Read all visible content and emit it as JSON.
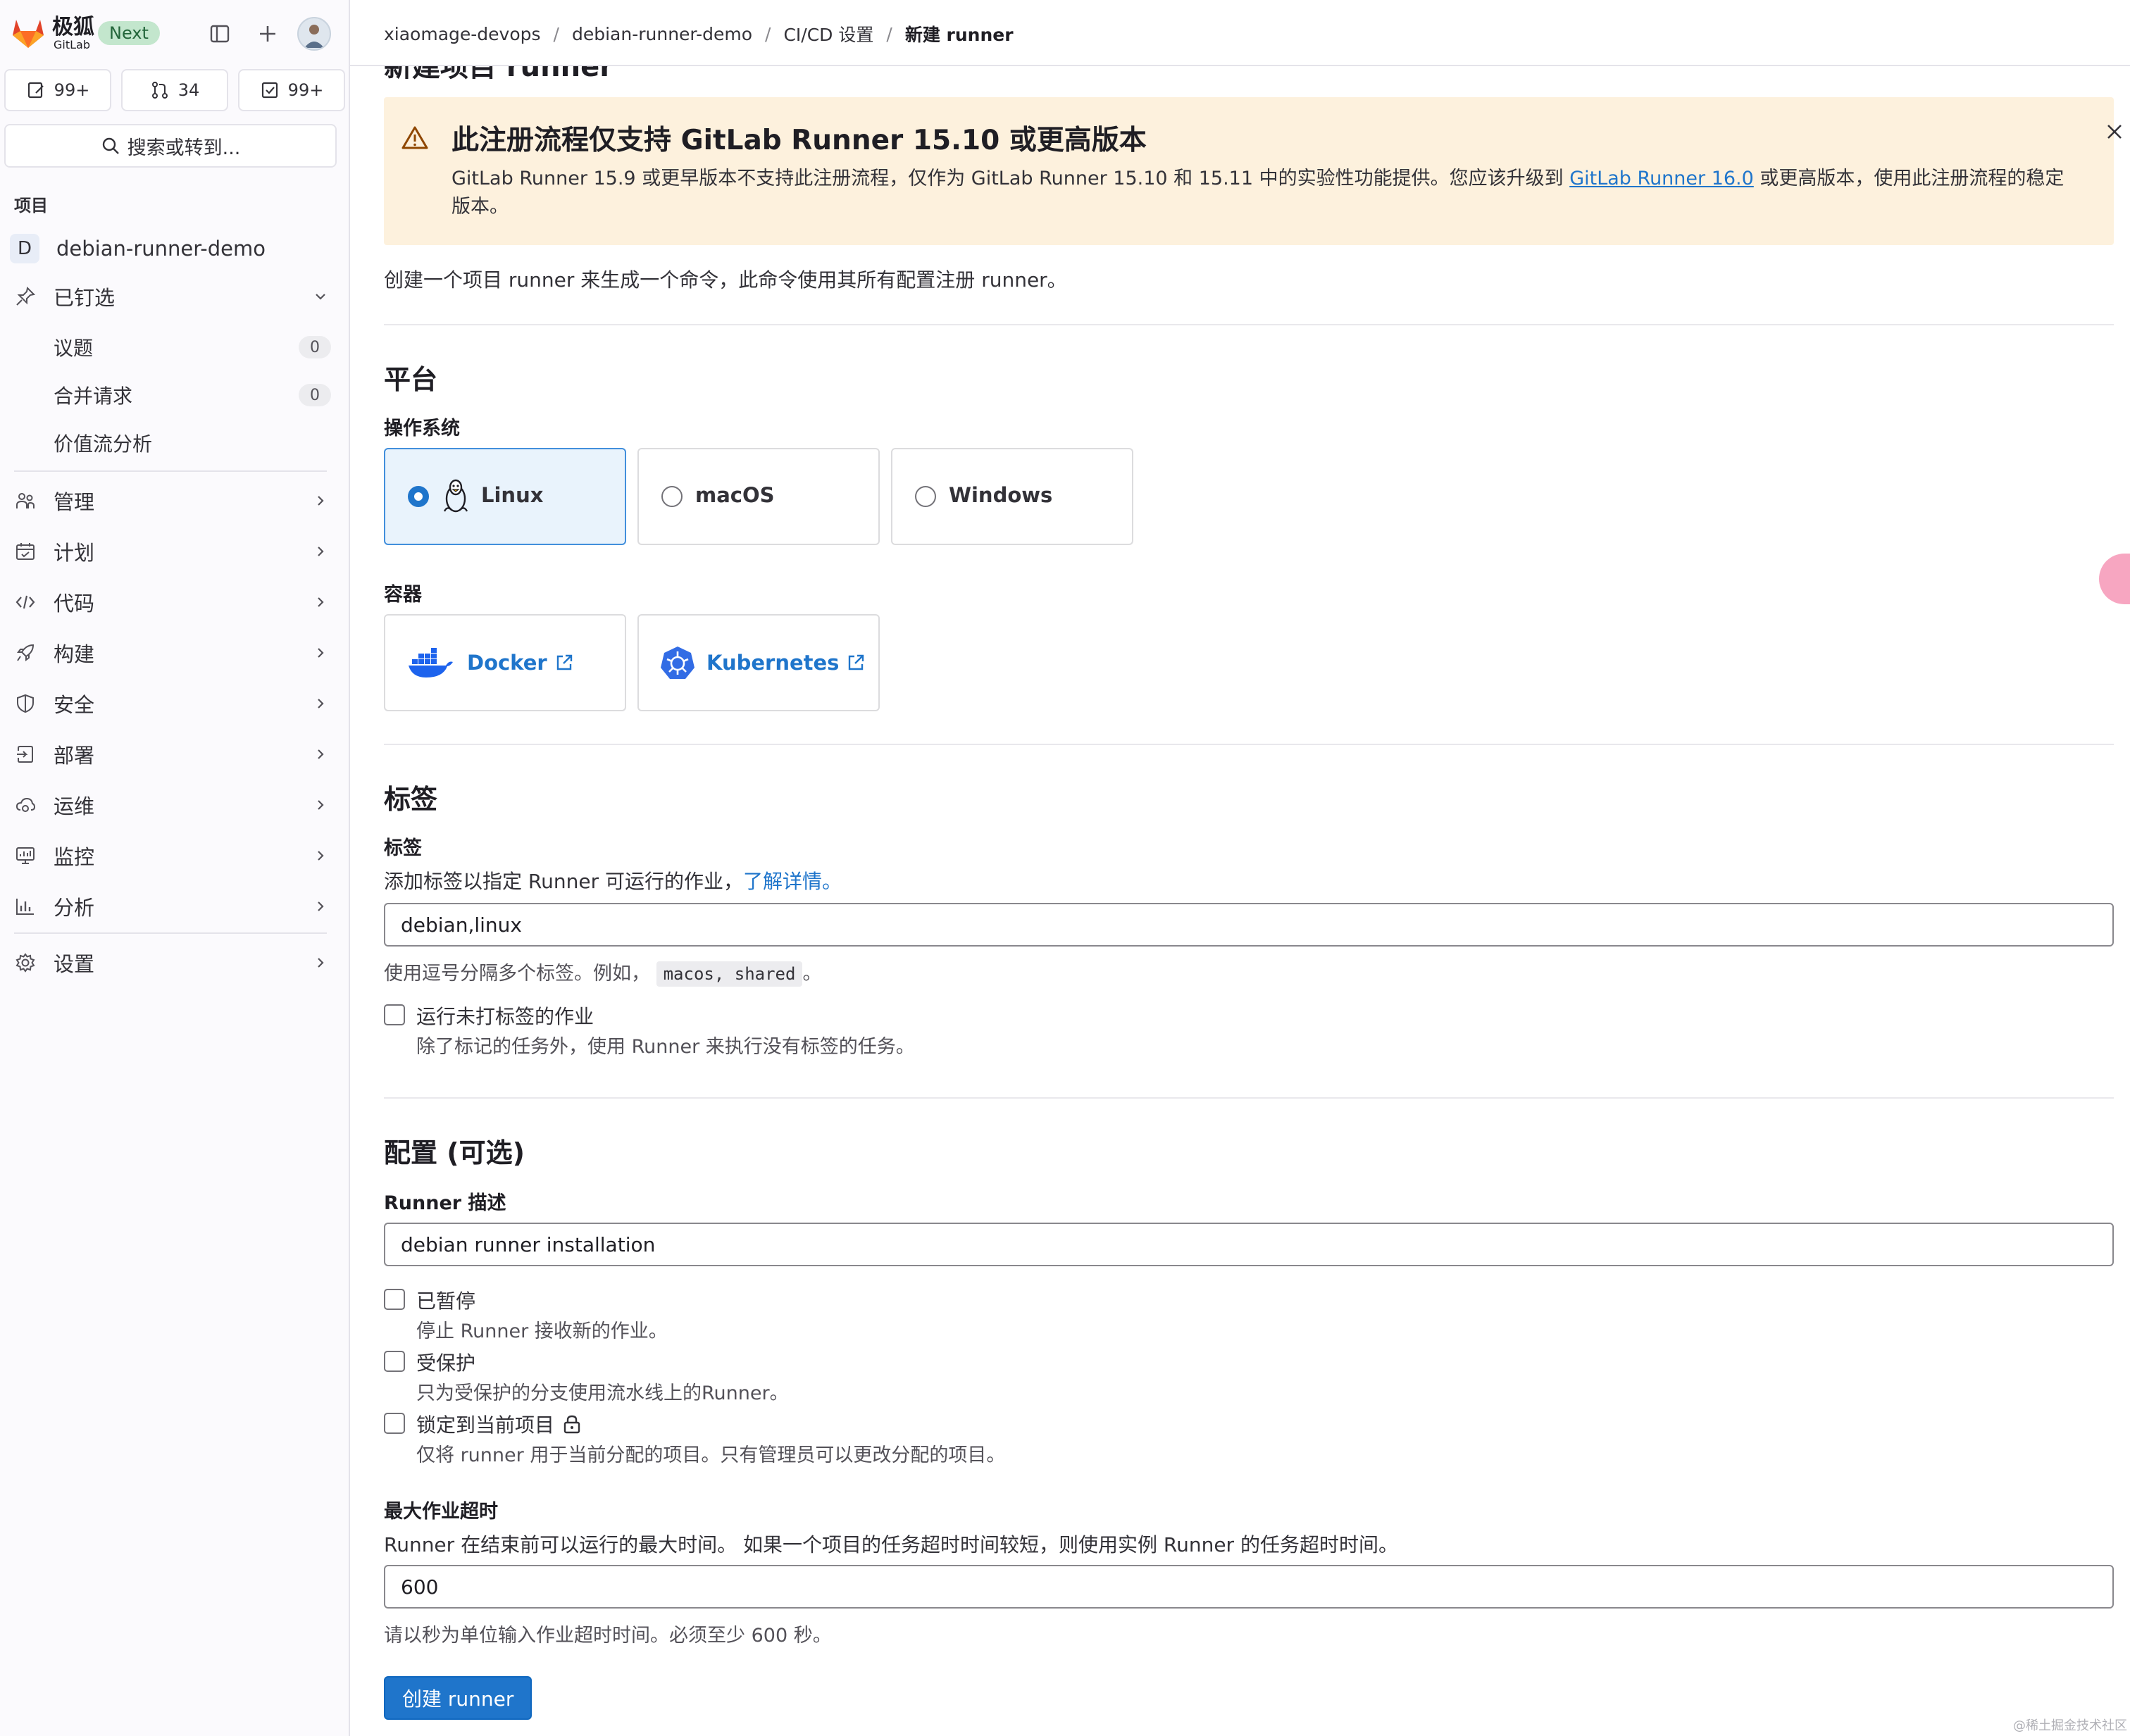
{
  "sidebar": {
    "brand_cn": "极狐",
    "brand_en": "GitLab",
    "next_badge": "Next",
    "counts": {
      "issues": "99+",
      "merge_requests": "34",
      "todos": "99+"
    },
    "search_label": "搜索或转到...",
    "section_label": "项目",
    "project_initial": "D",
    "project_name": "debian-runner-demo",
    "pinned_label": "已钉选",
    "pinned_items": [
      {
        "label": "议题",
        "count": "0"
      },
      {
        "label": "合并请求",
        "count": "0"
      },
      {
        "label": "价值流分析"
      }
    ],
    "nav": [
      {
        "label": "管理",
        "icon": "users-icon"
      },
      {
        "label": "计划",
        "icon": "calendar-icon"
      },
      {
        "label": "代码",
        "icon": "code-icon"
      },
      {
        "label": "构建",
        "icon": "rocket-icon"
      },
      {
        "label": "安全",
        "icon": "shield-icon"
      },
      {
        "label": "部署",
        "icon": "deploy-icon"
      },
      {
        "label": "运维",
        "icon": "cloud-gear-icon"
      },
      {
        "label": "监控",
        "icon": "monitor-icon"
      },
      {
        "label": "分析",
        "icon": "chart-icon"
      }
    ],
    "settings_label": "设置"
  },
  "breadcrumbs": [
    "xiaomage-devops",
    "debian-runner-demo",
    "CI/CD 设置",
    "新建 runner"
  ],
  "page_title": "新建项目 runner",
  "alert": {
    "title": "此注册流程仅支持 GitLab Runner 15.10 或更高版本",
    "body_before": "GitLab Runner 15.9 或更早版本不支持此注册流程，仅作为 GitLab Runner 15.10 和 15.11 中的实验性功能提供。您应该升级到 ",
    "link_text": "GitLab Runner 16.0",
    "body_after": " 或更高版本，使用此注册流程的稳定版本。"
  },
  "intro": "创建一个项目 runner 来生成一个命令，此命令使用其所有配置注册 runner。",
  "platform": {
    "heading": "平台",
    "os_label": "操作系统",
    "os_options": [
      "Linux",
      "macOS",
      "Windows"
    ],
    "selected_os": "Linux",
    "containers_label": "容器",
    "containers": [
      "Docker",
      "Kubernetes"
    ]
  },
  "tags": {
    "heading": "标签",
    "label": "标签",
    "help_text": "添加标签以指定 Runner 可运行的作业，",
    "help_link": "了解详情。",
    "value": "debian,linux",
    "hint_before": "使用逗号分隔多个标签。例如，",
    "hint_code": "macos, shared",
    "hint_after": "。",
    "run_untagged_label": "运行未打标签的作业",
    "run_untagged_help": "除了标记的任务外，使用 Runner 来执行没有标签的任务。"
  },
  "config": {
    "heading": "配置 (可选)",
    "description_label": "Runner 描述",
    "description_value": "debian runner installation",
    "paused_label": "已暂停",
    "paused_help": "停止 Runner 接收新的作业。",
    "protected_label": "受保护",
    "protected_help": "只为受保护的分支使用流水线上的Runner。",
    "locked_label": "锁定到当前项目",
    "locked_help": "仅将 runner 用于当前分配的项目。只有管理员可以更改分配的项目。",
    "timeout_label": "最大作业超时",
    "timeout_help": "Runner 在结束前可以运行的最大时间。 如果一个项目的任务超时时间较短，则使用实例 Runner 的任务超时时间。",
    "timeout_value": "600",
    "timeout_hint": "请以秒为单位输入作业超时时间。必须至少 600 秒。"
  },
  "submit_label": "创建 runner",
  "watermark": "@稀土掘金技术社区",
  "colors": {
    "primary": "#1f75cb",
    "alert_bg": "#fdf1dd",
    "next_badge_bg": "#c3e6cd"
  }
}
